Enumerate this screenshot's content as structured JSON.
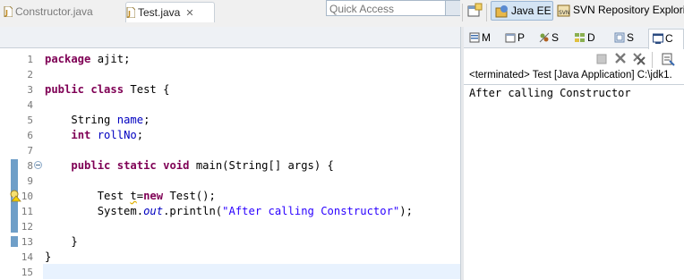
{
  "toolbar": {
    "quick_access_placeholder": "Quick Access",
    "perspectives": [
      {
        "label": "Java EE",
        "active": true
      },
      {
        "label": "SVN Repository Exploring",
        "active": false
      }
    ]
  },
  "editor": {
    "tabs": [
      {
        "label": "Constructor.java",
        "active": false
      },
      {
        "label": "Test.java",
        "active": true
      }
    ],
    "line_numbers": [
      "1",
      "2",
      "3",
      "4",
      "5",
      "6",
      "7",
      "8",
      "9",
      "10",
      "11",
      "12",
      "13",
      "14",
      "15"
    ]
  },
  "view": {
    "tabs": [
      {
        "label": "M",
        "icon": "markers-icon"
      },
      {
        "label": "P",
        "icon": "properties-icon"
      },
      {
        "label": "S",
        "icon": "servers-icon"
      },
      {
        "label": "D",
        "icon": "data-source-icon"
      },
      {
        "label": "S",
        "icon": "snippets-icon"
      },
      {
        "label": "C",
        "icon": "console-icon"
      }
    ],
    "console_status": "<terminated> Test [Java Application] C:\\jdk1.",
    "console_output": "After calling Constructor"
  },
  "colors": {
    "keyword": "#7f0055",
    "field": "#0000c0",
    "string": "#2a00ff",
    "current_line": "#e8f2fe",
    "active_perspective": "#d4e4f4"
  }
}
